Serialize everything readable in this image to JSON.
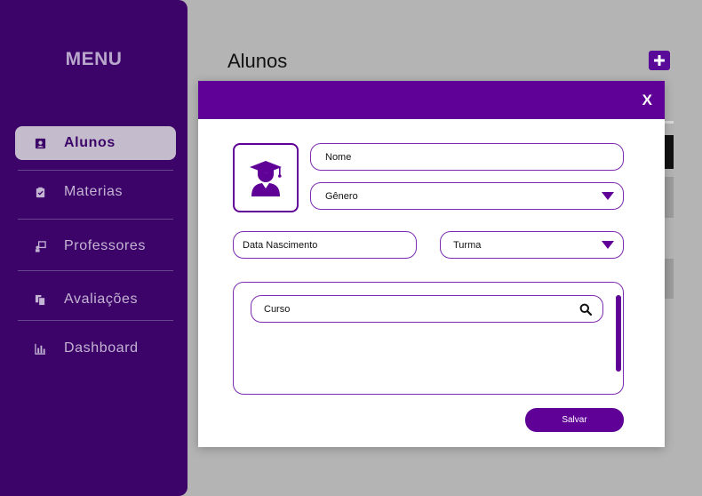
{
  "sidebar": {
    "title": "MENU",
    "items": [
      {
        "label": "Alunos",
        "icon": "student-icon"
      },
      {
        "label": "Materias",
        "icon": "clipboard-check-icon"
      },
      {
        "label": "Professores",
        "icon": "teacher-board-icon"
      },
      {
        "label": "Avaliações",
        "icon": "documents-icon"
      },
      {
        "label": "Dashboard",
        "icon": "bar-chart-icon"
      }
    ]
  },
  "page": {
    "title": "Alunos",
    "add_icon": "plus-icon"
  },
  "modal": {
    "close_label": "X",
    "avatar_icon": "graduate-icon",
    "fields": {
      "nome": {
        "label": "Nome"
      },
      "genero": {
        "label": "Gênero"
      },
      "data_nascimento": {
        "label": "Data Nascimento"
      },
      "turma": {
        "label": "Turma"
      },
      "curso": {
        "label": "Curso"
      }
    },
    "save_label": "Salvar"
  },
  "colors": {
    "primary": "#5f0096",
    "sidebar_bg": "#3c0469",
    "overlay_bg": "#b4b4b4"
  }
}
